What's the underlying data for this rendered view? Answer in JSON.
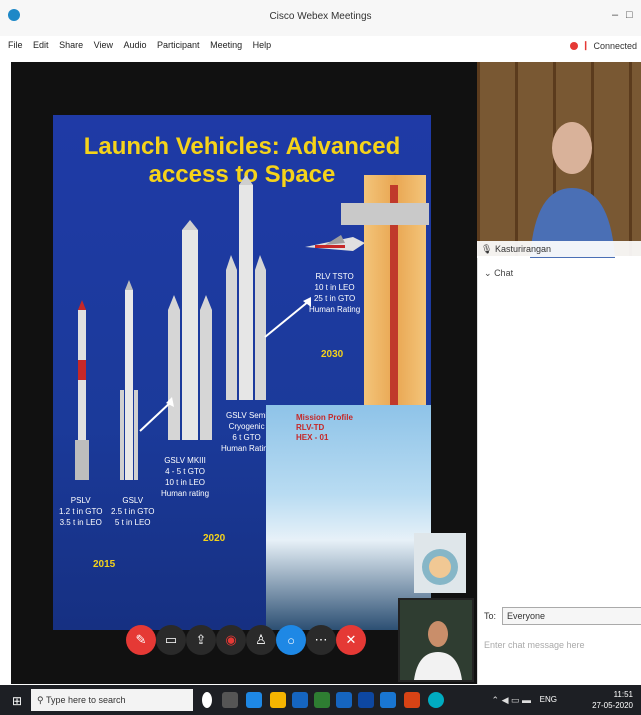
{
  "window": {
    "title": "Cisco Webex Meetings",
    "min_label": "–",
    "restore_label": "           "
  },
  "menu": {
    "items": [
      "File",
      "Edit",
      "Share",
      "View",
      "Audio",
      "Participant",
      "Meeting",
      "Help"
    ],
    "connection": "Connected"
  },
  "slide": {
    "title": "Launch Vehicles: Advanced access to Space",
    "vehicles": [
      {
        "name": "PSLV",
        "lines": [
          "PSLV",
          "1.2 t in GTO",
          "3.5 t in LEO"
        ]
      },
      {
        "name": "GSLV",
        "lines": [
          "GSLV",
          "2.5 t in GTO",
          "5 t in LEO"
        ]
      },
      {
        "name": "GSLV MKIII",
        "lines": [
          "GSLV MKIII",
          "4 - 5 t GTO",
          "10 t in LEO",
          "Human rating"
        ]
      },
      {
        "name": "GSLV Semi Cryogenic",
        "lines": [
          "GSLV Semi",
          "Cryogenic",
          "6 t GTO",
          "Human Rating"
        ]
      },
      {
        "name": "RLV TSTO",
        "lines": [
          "RLV TSTO",
          "10 t in LEO",
          "25 t in GTO",
          "Human Rating"
        ]
      }
    ],
    "years": [
      "2015",
      "2020",
      "2030"
    ],
    "mission_title_line1": "Mission Profile",
    "mission_title_line2": "RLV-TD",
    "mission_title_line3": "HEX - 01"
  },
  "participant": {
    "name": "Kasturirangan"
  },
  "chat": {
    "header": "Chat",
    "to_label": "To:",
    "to_value": "Everyone",
    "placeholder": "Enter chat message here"
  },
  "taskbar": {
    "search_placeholder": "Type here to search",
    "lang": "ENG",
    "time": "11:51",
    "date": "27-05-2020"
  },
  "colors": {
    "accent": "#f5d31a",
    "slide_bg": "#1f3aa6",
    "danger": "#e53935"
  }
}
